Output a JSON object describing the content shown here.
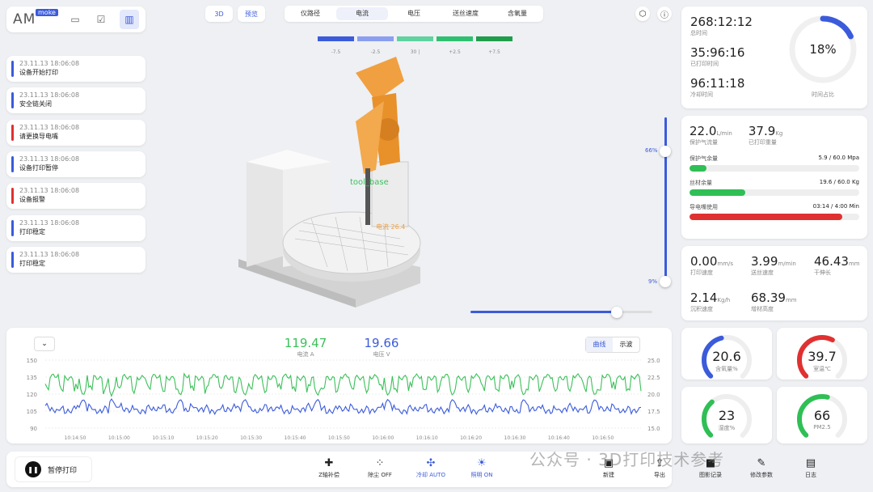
{
  "logo": {
    "text": "AM",
    "badge": "moke"
  },
  "toolbar_icons": [
    "panel-icon",
    "checklist-icon",
    "bar-chart-icon"
  ],
  "logs": [
    {
      "time": "23.11.13  18:06:08",
      "msg": "设备开始打印",
      "color": "#3b5bdb"
    },
    {
      "time": "23.11.13  18:06:08",
      "msg": "安全链关闭",
      "color": "#3b5bdb"
    },
    {
      "time": "23.11.13  18:06:08",
      "msg": "请更换导电嘴",
      "color": "#e03131"
    },
    {
      "time": "23.11.13  18:06:08",
      "msg": "设备打印暂停",
      "color": "#3b5bdb"
    },
    {
      "time": "23.11.13  18:06:08",
      "msg": "设备报警",
      "color": "#e03131"
    },
    {
      "time": "23.11.13  18:06:08",
      "msg": "打印稳定",
      "color": "#3b5bdb"
    },
    {
      "time": "23.11.13  18:06:08",
      "msg": "打印稳定",
      "color": "#3b5bdb"
    }
  ],
  "view_buttons": {
    "view3d": "3D",
    "preview": "预览"
  },
  "tabs": [
    "仪路径",
    "电流",
    "电压",
    "送丝速度",
    "含氧量"
  ],
  "active_tab": 1,
  "color_legend": [
    {
      "label": "-7.5",
      "color": "#3b5bdb"
    },
    {
      "label": "-2.5",
      "color": "#8b9ef0"
    },
    {
      "label": "30 |",
      "color": "#5fd2a0"
    },
    {
      "label": "+2.5",
      "color": "#2fbf71"
    },
    {
      "label": "+7.5",
      "color": "#1f9d4c"
    }
  ],
  "viewport": {
    "tool_label": "tool_base",
    "current_label": "电流 26.4",
    "slider_top": "66%",
    "slider_bottom": "9%"
  },
  "time_card": {
    "total_time": "268:12:12",
    "total_label": "总时间",
    "print_time": "35:96:16",
    "print_label": "已打印时间",
    "cool_time": "96:11:18",
    "cool_label": "冷却时间",
    "ratio": "18%",
    "ratio_value": 18,
    "ratio_label": "时间占比"
  },
  "gas_card": {
    "flow": "22.0",
    "flow_unit": "L/min",
    "flow_label": "保护气流量",
    "weight": "37.9",
    "weight_unit": "Kg",
    "weight_label": "已打印重量",
    "bars": [
      {
        "label": "保护气余量",
        "value": "5.9 / 60.0 Mpa",
        "fraction": 0.098,
        "color": "#2fbf55"
      },
      {
        "label": "丝材余量",
        "value": "19.6 / 60.0 Kg",
        "fraction": 0.327,
        "color": "#2fbf55"
      },
      {
        "label": "导电嘴使用",
        "value": "03:14 / 4:00 Min",
        "fraction": 0.9,
        "color": "#e03131"
      }
    ]
  },
  "speed_card": [
    {
      "value": "0.00",
      "unit": "mm/s",
      "label": "打印速度"
    },
    {
      "value": "3.99",
      "unit": "m/min",
      "label": "送丝速度"
    },
    {
      "value": "46.43",
      "unit": "mm",
      "label": "干伸长"
    },
    {
      "value": "2.14",
      "unit": "Kg/h",
      "label": "沉积速度"
    },
    {
      "value": "68.39",
      "unit": "mm",
      "label": "增材高度"
    }
  ],
  "gauges": [
    {
      "value": "20.6",
      "label": "含氧量%",
      "color": "#3b5bdb",
      "fraction": 0.45
    },
    {
      "value": "39.7",
      "label": "室温℃",
      "color": "#e03131",
      "fraction": 0.6
    },
    {
      "value": "23",
      "label": "湿度%",
      "color": "#2fbf55",
      "fraction": 0.35
    },
    {
      "value": "66",
      "label": "PM2.5",
      "color": "#2fbf55",
      "fraction": 0.55
    }
  ],
  "chart_data": {
    "type": "line",
    "current_value": "119.47",
    "current_label": "电流 A",
    "voltage_value": "19.66",
    "voltage_label": "电压 V",
    "modes": [
      "曲线",
      "示波"
    ],
    "y_left": {
      "ticks": [
        "150",
        "135",
        "120",
        "105",
        "90"
      ],
      "range": [
        90,
        150
      ]
    },
    "y_right": {
      "ticks": [
        "25.0",
        "22.5",
        "20.0",
        "17.5",
        "15.0"
      ],
      "range": [
        15,
        25
      ]
    },
    "x_ticks": [
      "10:14:50",
      "10:15:00",
      "10:15:10",
      "10:15:20",
      "10:15:30",
      "10:15:40",
      "10:15:50",
      "10:16:00",
      "10:16:10",
      "10:16:20",
      "10:16:30",
      "10:16:40",
      "10:16:50"
    ],
    "series": [
      {
        "name": "电流 A",
        "color": "#3cc05a",
        "base": 135,
        "dip": 118
      },
      {
        "name": "电压 V",
        "color": "#3b5bdb",
        "base": 17.6,
        "peak": 19.0
      }
    ]
  },
  "bottom": {
    "pause": "暂停打印",
    "tools": [
      {
        "icon": "puzzle-icon",
        "glyph": "✚",
        "label": "Z轴补偿",
        "active": false
      },
      {
        "icon": "dust-icon",
        "glyph": "⁘",
        "label": "除尘 OFF",
        "active": false
      },
      {
        "icon": "fan-icon",
        "glyph": "✣",
        "label": "冷却 AUTO",
        "active": true
      },
      {
        "icon": "light-icon",
        "glyph": "☀",
        "label": "照明 ON",
        "active": true
      },
      {
        "icon": "new-folder-icon",
        "glyph": "▣",
        "label": "新建",
        "active": false
      },
      {
        "icon": "export-icon",
        "glyph": "⇪",
        "label": "导出",
        "active": false
      },
      {
        "icon": "video-icon",
        "glyph": "■",
        "label": "图影记录",
        "active": false
      },
      {
        "icon": "wrench-icon",
        "glyph": "✎",
        "label": "修改参数",
        "active": false
      },
      {
        "icon": "log-icon",
        "glyph": "▤",
        "label": "日志",
        "active": false
      }
    ]
  },
  "watermark": "公众号 · 3D打印技术参考"
}
